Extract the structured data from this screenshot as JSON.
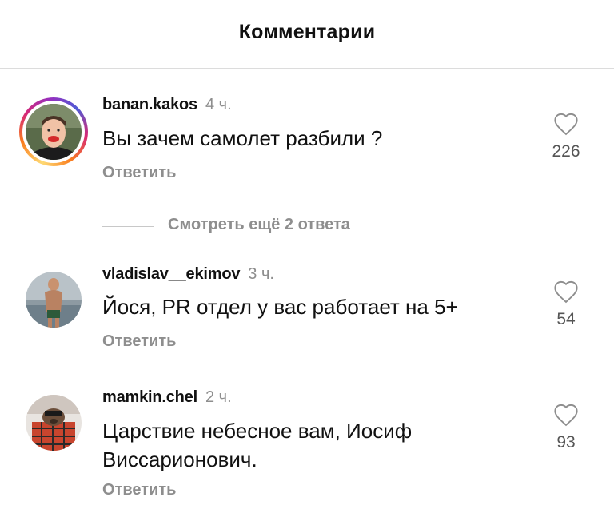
{
  "header": {
    "title": "Комментарии"
  },
  "comments": [
    {
      "username": "banan.kakos",
      "time": "4 ч.",
      "text": "Вы зачем самолет разбили ?",
      "reply_label": "Ответить",
      "likes": "226",
      "has_story_ring": true
    },
    {
      "username": "vladislav__ekimov",
      "time": "3 ч.",
      "text": "Йося, PR отдел у вас работает на 5+",
      "reply_label": "Ответить",
      "likes": "54",
      "has_story_ring": false
    },
    {
      "username": "mamkin.chel",
      "time": "2 ч.",
      "text": "Царствие небесное вам, Иосиф Виссарионович.",
      "reply_label": "Ответить",
      "likes": "93",
      "has_story_ring": false
    }
  ],
  "view_more_replies": "Смотреть ещё 2 ответа",
  "icons": {
    "like": "heart-outline-icon"
  },
  "colors": {
    "muted": "#8e8e8e",
    "text": "#111111",
    "divider": "#dcdcdc"
  }
}
